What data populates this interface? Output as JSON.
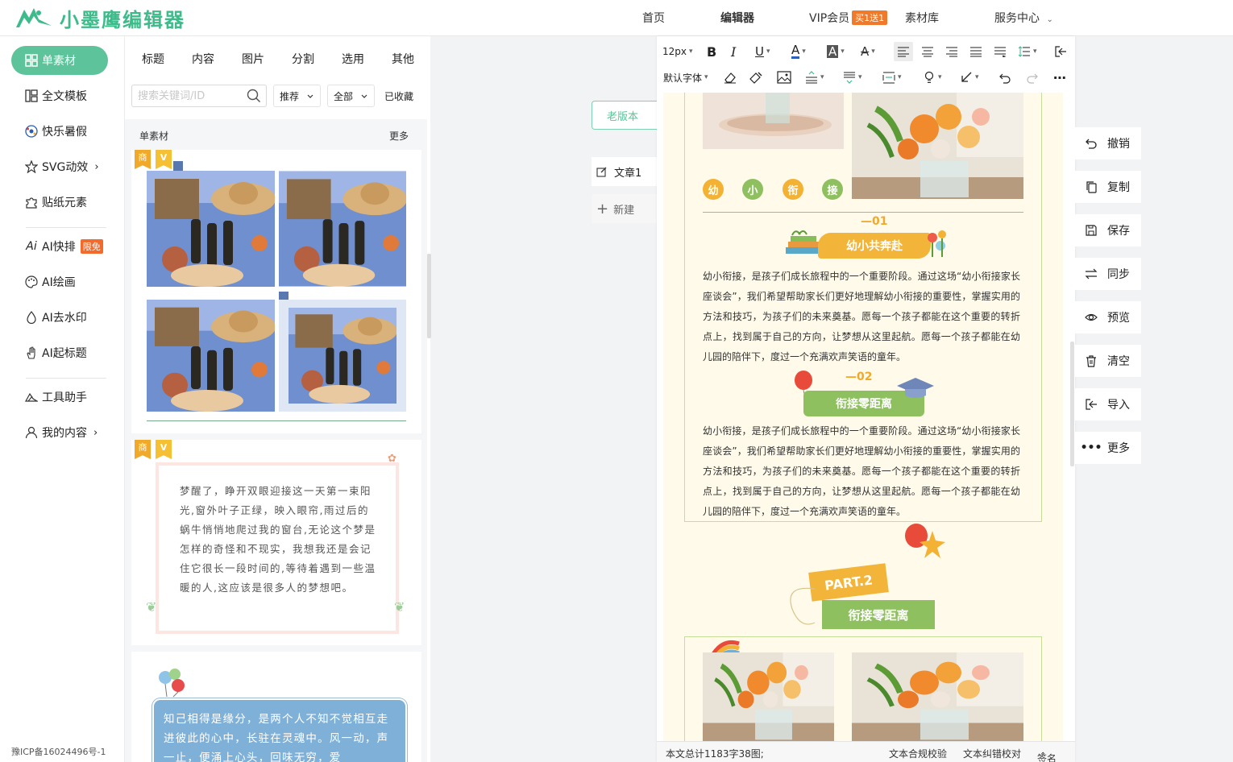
{
  "header": {
    "logo_text": "小墨鹰编辑器",
    "nav": [
      {
        "label": "首页",
        "active": false
      },
      {
        "label": "编辑器",
        "active": true
      },
      {
        "label": "VIP会员",
        "badge": "买1送1"
      },
      {
        "label": "素材库"
      },
      {
        "label": "服务中心",
        "dropdown": true
      }
    ]
  },
  "sidebar": {
    "items": [
      {
        "label": "单素材",
        "icon": "grid-icon",
        "active": true
      },
      {
        "label": "全文模板",
        "icon": "template-icon"
      },
      {
        "label": "快乐暑假",
        "icon": "ball-icon"
      },
      {
        "label": "SVG动效",
        "icon": "star-icon",
        "chevron": "›"
      },
      {
        "label": "贴纸元素",
        "icon": "puzzle-icon"
      },
      {
        "label": "AI快排",
        "icon": "ai-icon",
        "badge": "限免"
      },
      {
        "label": "AI绘画",
        "icon": "palette-icon"
      },
      {
        "label": "AI去水印",
        "icon": "drop-icon"
      },
      {
        "label": "AI起标题",
        "icon": "hand-icon"
      },
      {
        "label": "工具助手",
        "icon": "tools-icon"
      },
      {
        "label": "我的内容",
        "icon": "user-icon",
        "chevron": "›"
      }
    ],
    "icp": "豫ICP备16024496号-1"
  },
  "panel": {
    "tabs": [
      "标题",
      "内容",
      "图片",
      "分割",
      "选用",
      "其他"
    ],
    "search_placeholder": "搜索关键词/ID",
    "filter_sort": "推荐",
    "filter_range": "全部",
    "favorites": "已收藏",
    "section_title": "单素材",
    "more": "更多",
    "tag_shang": "商",
    "tag_v": "V",
    "poem": "梦醒了，睁开双眼迎接这一天第一束阳光,窗外叶子正绿，映入眼帘,雨过后的蜗牛悄悄地爬过我的窗台,无论这个梦是怎样的奇怪和不现实，我想我还是会记住它很长一段时间的,等待着遇到一些温暖的人,这应该是很多人的梦想吧。",
    "blue_text": "知己相得是缘分，是两个人不知不觉相互走进彼此的心中，长驻在灵魂中。风一动，声一止，便涌上心头，回味无穷，爱"
  },
  "middle": {
    "old_version": "老版本",
    "doc_tab": "文章1",
    "new_doc": "新建"
  },
  "toolbar": {
    "font_size": "12px",
    "font_family": "默认字体"
  },
  "canvas": {
    "circles": [
      "幼",
      "小",
      "衔",
      "接"
    ],
    "circle_colors": [
      "#f3b233",
      "#8fc060",
      "#f3b233",
      "#8fc060"
    ],
    "section1_num": "—01",
    "section1_title": "幼小共奔赴",
    "section2_num": "—02",
    "section2_title": "衔接零距离",
    "paragraph": "幼小衔接，是孩子们成长旅程中的一个重要阶段。通过这场“幼小衔接家长座谈会”，我们希望帮助家长们更好地理解幼小衔接的重要性，掌握实用的方法和技巧，为孩子们的未来奠基。愿每一个孩子都能在这个重要的转折点上，找到属于自己的方向，让梦想从这里起航。愿每一个孩子都能在幼儿园的陪伴下，度过一个充满欢声笑语的童年。",
    "part_label": "PART.2",
    "part_title": "衔接零距离"
  },
  "status": {
    "stats": "本文总计1183字38图;",
    "compliance": "文本合规校验",
    "proofread": "文本纠错校对",
    "signature": "签名"
  },
  "actions": [
    "撤销",
    "复制",
    "保存",
    "同步",
    "预览",
    "清空",
    "导入",
    "更多"
  ],
  "colors": {
    "brand": "#5cc39a",
    "orange": "#f0a92a",
    "green": "#8fc060",
    "canvas_bg": "#fffaea"
  }
}
